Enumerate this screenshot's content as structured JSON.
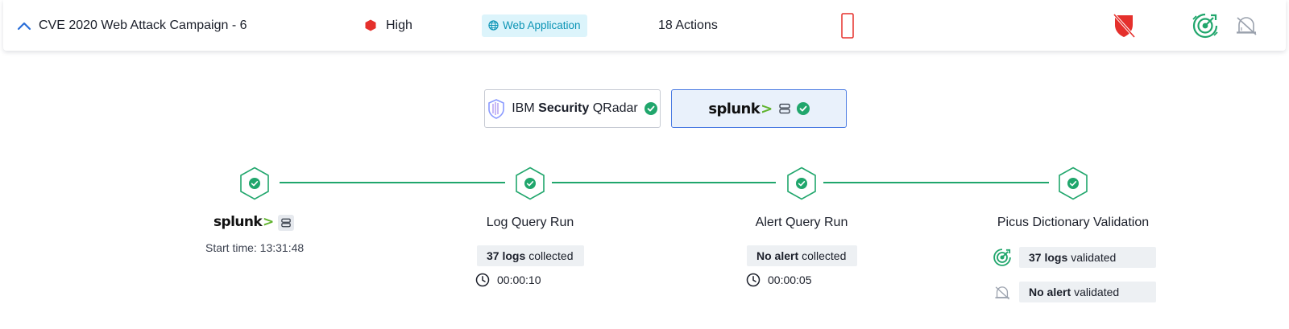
{
  "header": {
    "title": "CVE 2020 Web Attack Campaign - 6",
    "severity": {
      "label": "High",
      "color": "#e5302c"
    },
    "tag": {
      "label": "Web Application",
      "icon": "globe-icon"
    },
    "actions": "18 Actions",
    "icons": [
      "chevron-up-icon",
      "mobile-device-icon",
      "shield-off-icon",
      "target-icon",
      "alert-off-icon"
    ]
  },
  "integrations": {
    "qradar": {
      "brand_light": "IBM",
      "brand_bold": "Security",
      "product": "QRadar",
      "status_icon": "check-circle-icon"
    },
    "splunk": {
      "wordmark": "splunk",
      "chevron": ">",
      "status_icon": "check-circle-icon",
      "selected": true
    }
  },
  "pipeline": {
    "status_icon": "hexagon-check-icon",
    "steps": [
      {
        "kind": "source",
        "logo": "splunk",
        "chevron": ">",
        "start_time": "Start time: 13:31:48"
      },
      {
        "title": "Log Query Run",
        "count": "37 logs",
        "label": "collected",
        "duration": "00:00:10"
      },
      {
        "title": "Alert Query Run",
        "count": "No alert",
        "label": "collected",
        "duration": "00:00:05"
      },
      {
        "title": "Picus Dictionary Validation",
        "rows": [
          {
            "icon": "target-icon",
            "count": "37 logs",
            "label": "validated"
          },
          {
            "icon": "alert-off-icon",
            "count": "No alert",
            "label": "validated"
          }
        ]
      }
    ]
  },
  "colors": {
    "accent_green": "#20a66c",
    "brand_blue": "#2a6ed8",
    "tag_bg": "#dcf4fb",
    "tag_text": "#0b94b5",
    "danger": "#e5302c"
  }
}
